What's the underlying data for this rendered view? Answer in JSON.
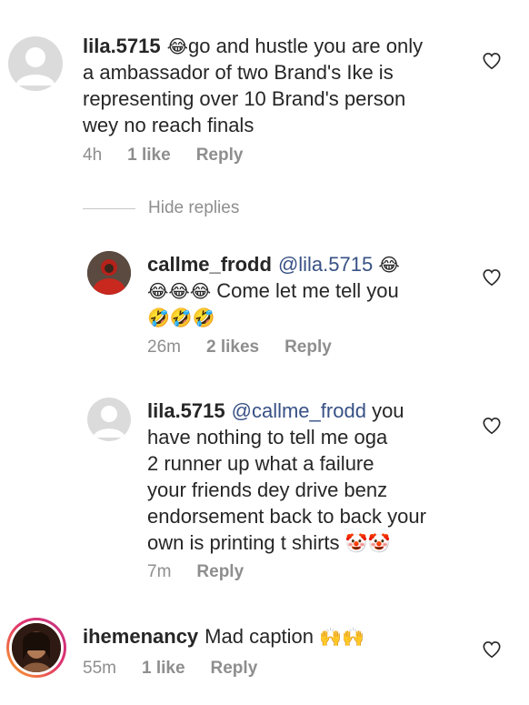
{
  "comments": [
    {
      "username": "lila.5715",
      "lines": [
        "go and hustle you are only",
        "a ambassador of two Brand's Ike is",
        "representing over 10 Brand's person",
        "wey no reach finals"
      ],
      "emoji_first": "😂",
      "time": "4h",
      "likes": "1 like",
      "reply": "Reply"
    },
    {
      "username": "callme_frodd",
      "mention": "@lila.5715",
      "line1_emoji": "😂",
      "line2_emojis": "😂😂😂",
      "line2_text": "Come let me tell you",
      "line3_emojis": "🤣🤣🤣",
      "time": "26m",
      "likes": "2 likes",
      "reply": "Reply"
    },
    {
      "username": "lila.5715",
      "mention": "@callme_frodd",
      "line1_text": "you",
      "lines": [
        "have nothing to tell me oga",
        "2 runner up what a failure",
        "your friends dey drive benz",
        "endorsement back to back your"
      ],
      "last_line": "own is printing t shirts",
      "last_emojis": "🤡🤡",
      "time": "7m",
      "reply": "Reply"
    },
    {
      "username": "ihemenancy",
      "text": "Mad caption",
      "emojis": "🙌🙌",
      "time": "55m",
      "likes": "1 like",
      "reply": "Reply"
    }
  ],
  "hide_replies": "Hide replies",
  "colors": {
    "text": "#262626",
    "meta": "#8e8e8e",
    "mention": "#385185",
    "divider": "#c7c7c7"
  },
  "icons": [
    "default-avatar-icon",
    "heart-outline-icon"
  ]
}
